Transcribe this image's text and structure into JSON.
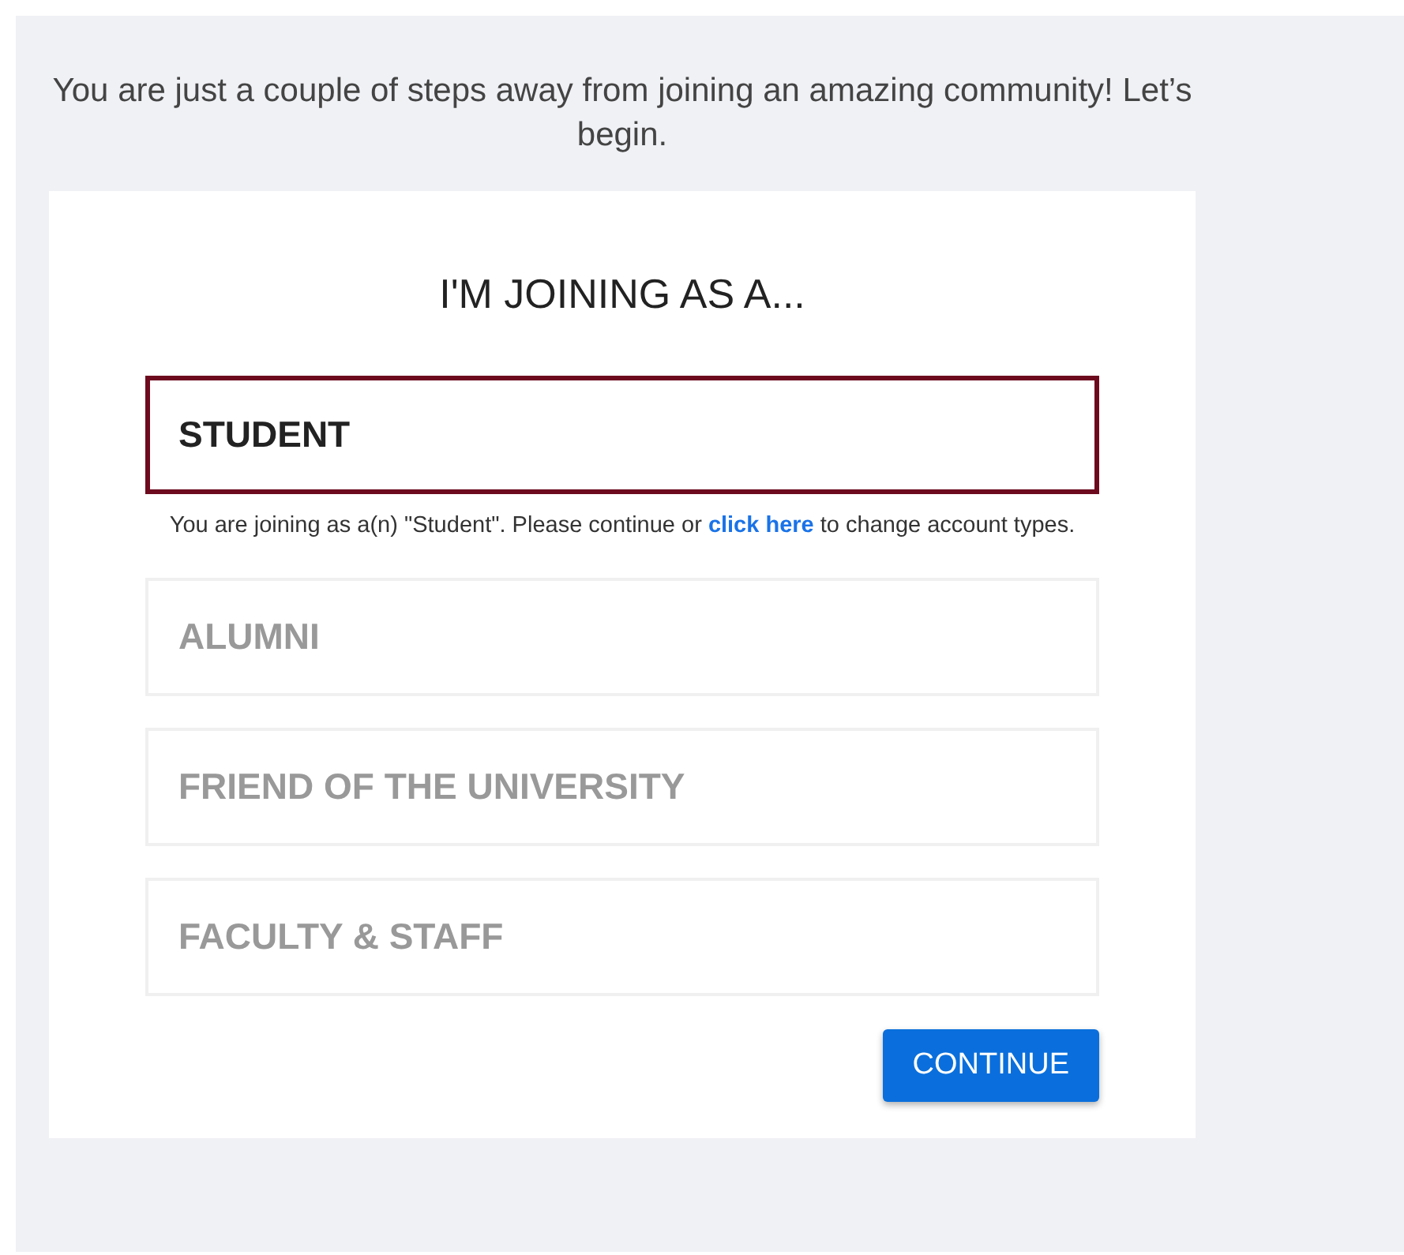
{
  "intro": "You are just a couple of steps away from joining an amazing community! Let’s begin.",
  "heading": "I'M JOINING AS A...",
  "options": [
    {
      "label": "STUDENT",
      "selected": true
    },
    {
      "label": "ALUMNI",
      "selected": false
    },
    {
      "label": "FRIEND OF THE UNIVERSITY",
      "selected": false
    },
    {
      "label": "FACULTY & STAFF",
      "selected": false
    }
  ],
  "selection_note": {
    "before": "You are joining as a(n) \"Student\". Please continue or ",
    "link": "click here",
    "after": " to change account types."
  },
  "continue_button": "CONTINUE"
}
